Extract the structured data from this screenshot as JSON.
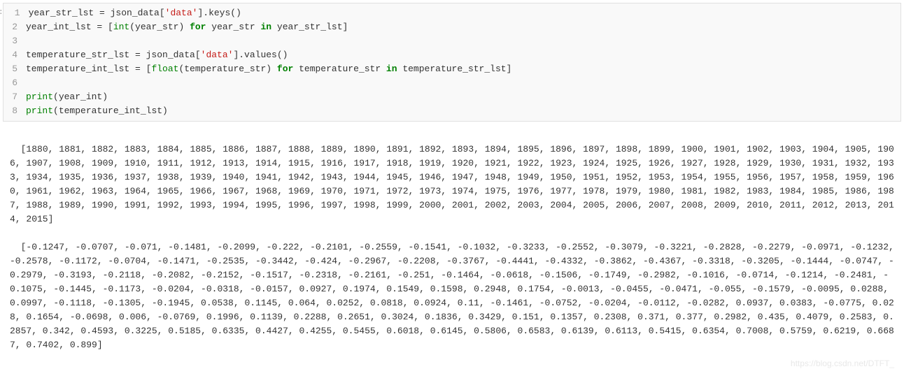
{
  "code": {
    "lines": [
      {
        "num": "1",
        "tokens": [
          {
            "t": "year_str_lst = json_data[",
            "c": ""
          },
          {
            "t": "'data'",
            "c": "s-string"
          },
          {
            "t": "].keys()",
            "c": ""
          }
        ]
      },
      {
        "num": "2",
        "tokens": [
          {
            "t": "year_int_lst = [",
            "c": ""
          },
          {
            "t": "int",
            "c": "s-builtin"
          },
          {
            "t": "(year_str) ",
            "c": ""
          },
          {
            "t": "for",
            "c": "s-keyword"
          },
          {
            "t": " year_str ",
            "c": ""
          },
          {
            "t": "in",
            "c": "s-keyword"
          },
          {
            "t": " year_str_lst]",
            "c": ""
          }
        ]
      },
      {
        "num": "3",
        "tokens": []
      },
      {
        "num": "4",
        "tokens": [
          {
            "t": "temperature_str_lst = json_data[",
            "c": ""
          },
          {
            "t": "'data'",
            "c": "s-string"
          },
          {
            "t": "].values()",
            "c": ""
          }
        ]
      },
      {
        "num": "5",
        "tokens": [
          {
            "t": "temperature_int_lst = [",
            "c": ""
          },
          {
            "t": "float",
            "c": "s-builtin"
          },
          {
            "t": "(temperature_str) ",
            "c": ""
          },
          {
            "t": "for",
            "c": "s-keyword"
          },
          {
            "t": " temperature_str ",
            "c": ""
          },
          {
            "t": "in",
            "c": "s-keyword"
          },
          {
            "t": " temperature_str_lst]",
            "c": ""
          }
        ]
      },
      {
        "num": "6",
        "tokens": []
      },
      {
        "num": "7",
        "tokens": [
          {
            "t": "print",
            "c": "s-builtin"
          },
          {
            "t": "(year_int)",
            "c": ""
          }
        ]
      },
      {
        "num": "8",
        "tokens": [
          {
            "t": "print",
            "c": "s-builtin"
          },
          {
            "t": "(temperature_int_lst)",
            "c": ""
          }
        ]
      }
    ]
  },
  "output": {
    "years": "[1880, 1881, 1882, 1883, 1884, 1885, 1886, 1887, 1888, 1889, 1890, 1891, 1892, 1893, 1894, 1895, 1896, 1897, 1898, 1899, 1900, 1901, 1902, 1903, 1904, 1905, 1906, 1907, 1908, 1909, 1910, 1911, 1912, 1913, 1914, 1915, 1916, 1917, 1918, 1919, 1920, 1921, 1922, 1923, 1924, 1925, 1926, 1927, 1928, 1929, 1930, 1931, 1932, 1933, 1934, 1935, 1936, 1937, 1938, 1939, 1940, 1941, 1942, 1943, 1944, 1945, 1946, 1947, 1948, 1949, 1950, 1951, 1952, 1953, 1954, 1955, 1956, 1957, 1958, 1959, 1960, 1961, 1962, 1963, 1964, 1965, 1966, 1967, 1968, 1969, 1970, 1971, 1972, 1973, 1974, 1975, 1976, 1977, 1978, 1979, 1980, 1981, 1982, 1983, 1984, 1985, 1986, 1987, 1988, 1989, 1990, 1991, 1992, 1993, 1994, 1995, 1996, 1997, 1998, 1999, 2000, 2001, 2002, 2003, 2004, 2005, 2006, 2007, 2008, 2009, 2010, 2011, 2012, 2013, 2014, 2015]",
    "temps": "[-0.1247, -0.0707, -0.071, -0.1481, -0.2099, -0.222, -0.2101, -0.2559, -0.1541, -0.1032, -0.3233, -0.2552, -0.3079, -0.3221, -0.2828, -0.2279, -0.0971, -0.1232, -0.2578, -0.1172, -0.0704, -0.1471, -0.2535, -0.3442, -0.424, -0.2967, -0.2208, -0.3767, -0.4441, -0.4332, -0.3862, -0.4367, -0.3318, -0.3205, -0.1444, -0.0747, -0.2979, -0.3193, -0.2118, -0.2082, -0.2152, -0.1517, -0.2318, -0.2161, -0.251, -0.1464, -0.0618, -0.1506, -0.1749, -0.2982, -0.1016, -0.0714, -0.1214, -0.2481, -0.1075, -0.1445, -0.1173, -0.0204, -0.0318, -0.0157, 0.0927, 0.1974, 0.1549, 0.1598, 0.2948, 0.1754, -0.0013, -0.0455, -0.0471, -0.055, -0.1579, -0.0095, 0.0288, 0.0997, -0.1118, -0.1305, -0.1945, 0.0538, 0.1145, 0.064, 0.0252, 0.0818, 0.0924, 0.11, -0.1461, -0.0752, -0.0204, -0.0112, -0.0282, 0.0937, 0.0383, -0.0775, 0.028, 0.1654, -0.0698, 0.006, -0.0769, 0.1996, 0.1139, 0.2288, 0.2651, 0.3024, 0.1836, 0.3429, 0.151, 0.1357, 0.2308, 0.371, 0.377, 0.2982, 0.435, 0.4079, 0.2583, 0.2857, 0.342, 0.4593, 0.3225, 0.5185, 0.6335, 0.4427, 0.4255, 0.5455, 0.6018, 0.6145, 0.5806, 0.6583, 0.6139, 0.6113, 0.5415, 0.6354, 0.7008, 0.5759, 0.6219, 0.6687, 0.7402, 0.899]"
  },
  "label": ":",
  "watermark": "https://blog.csdn.net/DTFT_"
}
